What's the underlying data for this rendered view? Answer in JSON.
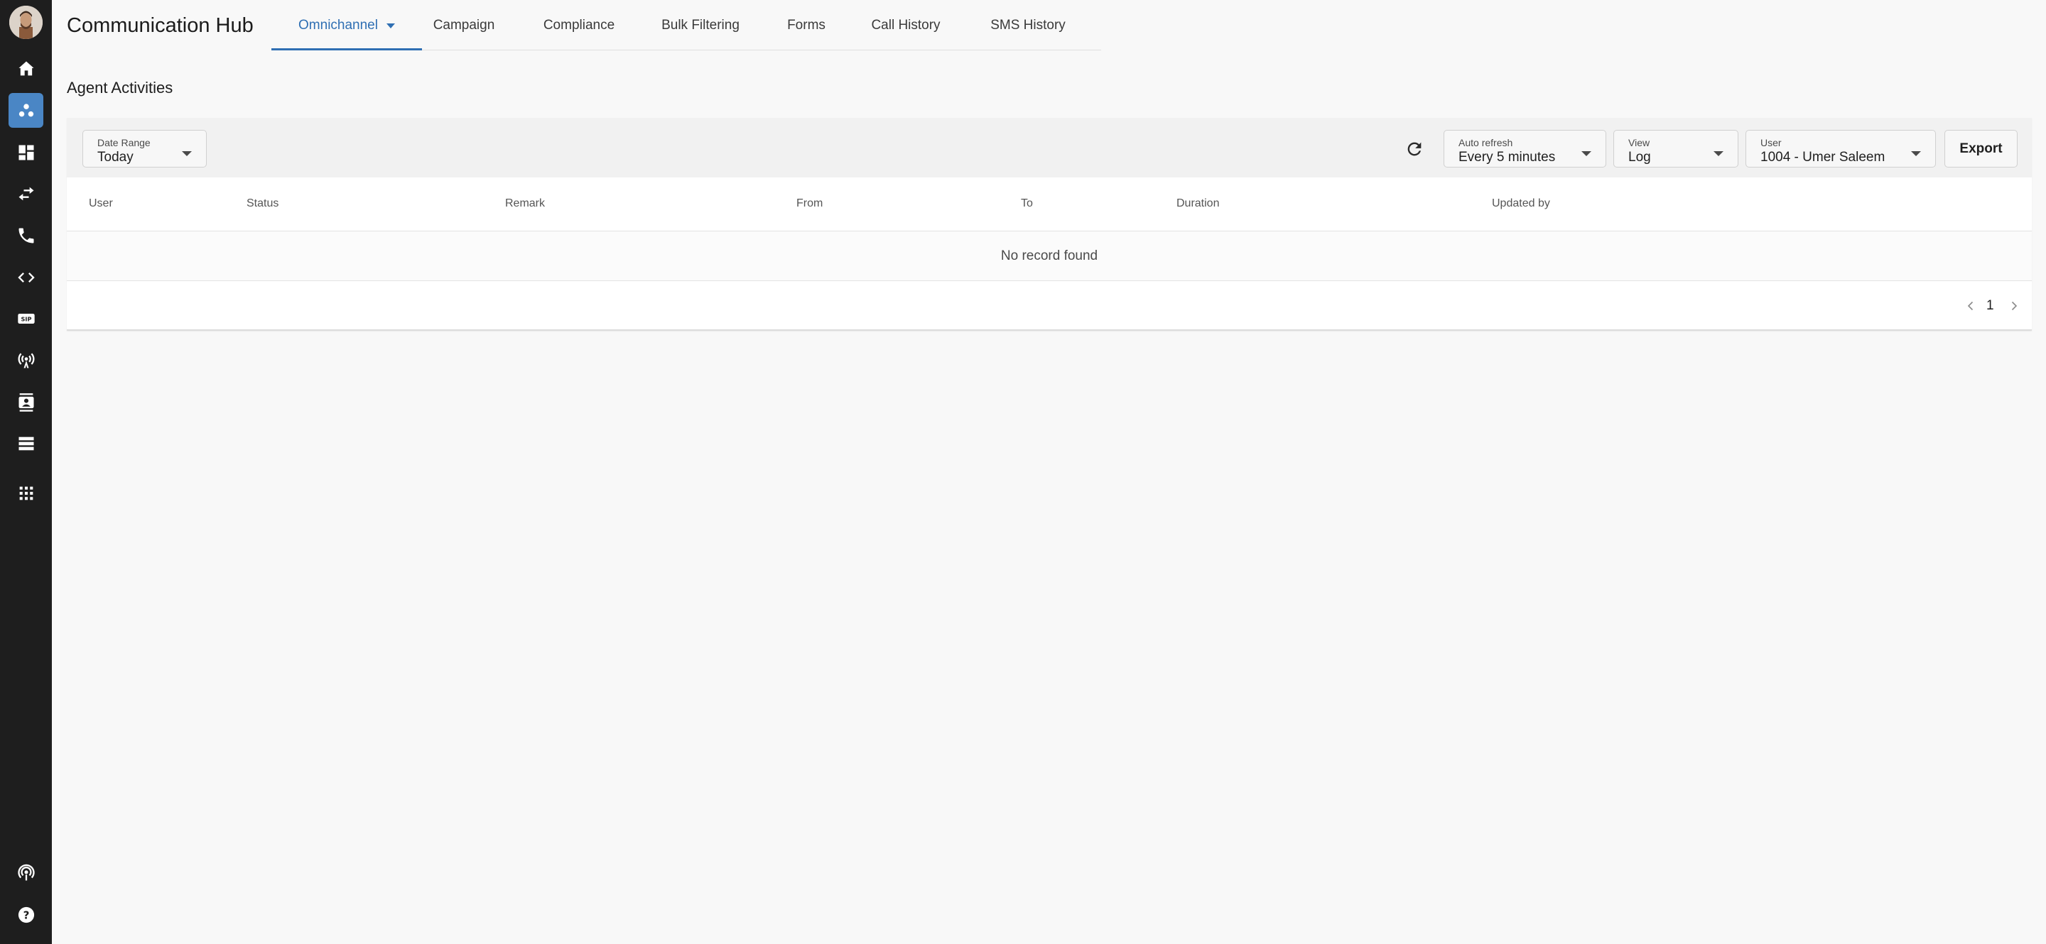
{
  "app": {
    "title": "Communication Hub"
  },
  "tabs": [
    {
      "label": "Omnichannel",
      "active": true
    },
    {
      "label": "Campaign"
    },
    {
      "label": "Compliance"
    },
    {
      "label": "Bulk Filtering"
    },
    {
      "label": "Forms"
    },
    {
      "label": "Call History"
    },
    {
      "label": "SMS History"
    }
  ],
  "sidebar": {
    "icons": [
      "home-icon",
      "groups-icon",
      "dashboard-icon",
      "transfer-icon",
      "phone-icon",
      "code-icon",
      "sip-icon",
      "broadcast-icon",
      "contacts-icon",
      "storage-icon",
      "apps-icon",
      "podcast-icon",
      "help-icon"
    ],
    "sip_text": "SIP",
    "help_text": "?"
  },
  "section": {
    "title": "Agent Activities"
  },
  "filters": {
    "date_range": {
      "label": "Date Range",
      "value": "Today"
    },
    "auto_refresh": {
      "label": "Auto refresh",
      "value": "Every 5 minutes"
    },
    "view": {
      "label": "View",
      "value": "Log"
    },
    "user": {
      "label": "User",
      "value": "1004 - Umer Saleem"
    },
    "export_label": "Export"
  },
  "table": {
    "columns": [
      "User",
      "Status",
      "Remark",
      "From",
      "To",
      "Duration",
      "Updated by"
    ],
    "empty_text": "No record found"
  },
  "pagination": {
    "current_page": "1"
  },
  "colors": {
    "sidebar_bg": "#1e1e1e",
    "accent": "#2f6fb3",
    "active_side": "#4a86c5"
  }
}
